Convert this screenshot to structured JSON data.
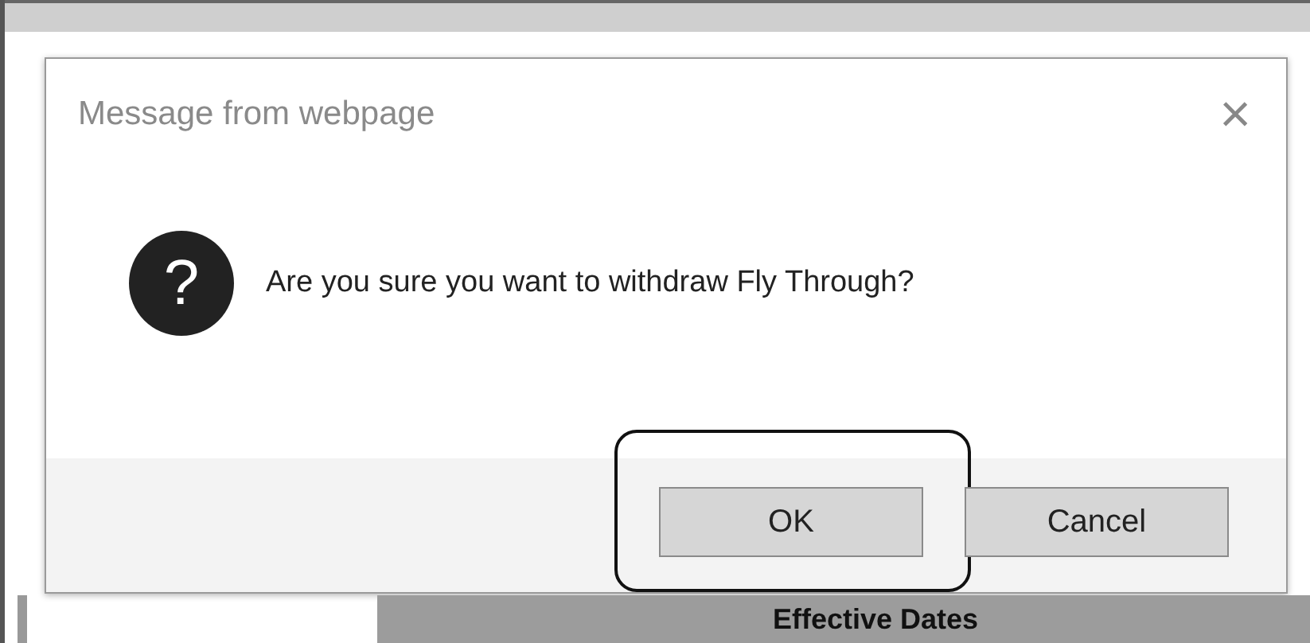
{
  "dialog": {
    "title": "Message from webpage",
    "close": "×",
    "icon": "?",
    "message": "Are you sure you want to withdraw Fly Through?",
    "buttons": [
      {
        "label": "OK",
        "highlighted": true
      },
      {
        "label": "Cancel",
        "highlighted": false
      }
    ]
  },
  "background_header": "Effective Dates"
}
